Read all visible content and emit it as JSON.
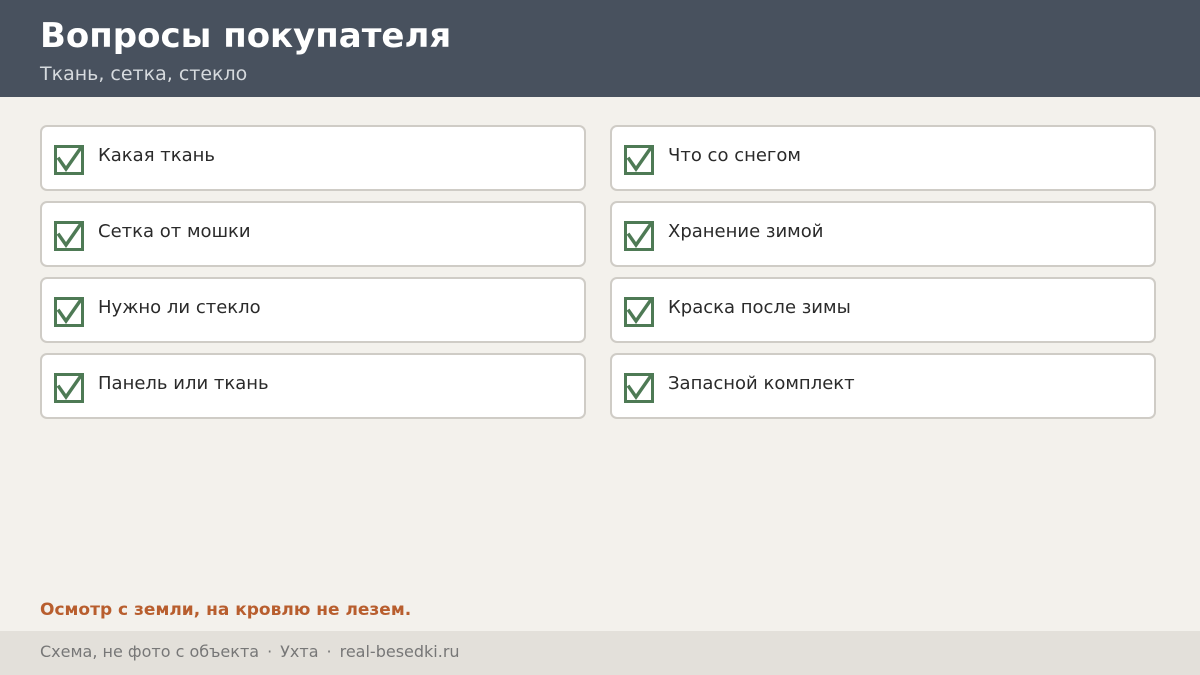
{
  "header": {
    "title": "Вопросы покупателя",
    "subtitle": "Ткань, сетка, стекло"
  },
  "checklist": {
    "left": [
      {
        "label": "Какая ткань",
        "checked": true
      },
      {
        "label": "Сетка от мошки",
        "checked": true
      },
      {
        "label": "Нужно ли стекло",
        "checked": true
      },
      {
        "label": "Панель или ткань",
        "checked": true
      }
    ],
    "right": [
      {
        "label": "Что со снегом",
        "checked": true
      },
      {
        "label": "Хранение зимой",
        "checked": true
      },
      {
        "label": "Краска после зимы",
        "checked": true
      },
      {
        "label": "Запасной комплект",
        "checked": true
      }
    ],
    "check_icon": "checkbox-checked-icon",
    "check_color": "#4e7a55"
  },
  "note": "Осмотр с земли, на кровлю не лезем.",
  "footer": {
    "part1": "Схема, не фото с объекта",
    "separator": "·",
    "part2": "Ухта",
    "part3": "real-besedki.ru"
  },
  "colors": {
    "header_bg": "#48515e",
    "page_bg": "#f3f1ec",
    "accent": "#b85e2e",
    "footer_bg": "#e3e0da"
  }
}
